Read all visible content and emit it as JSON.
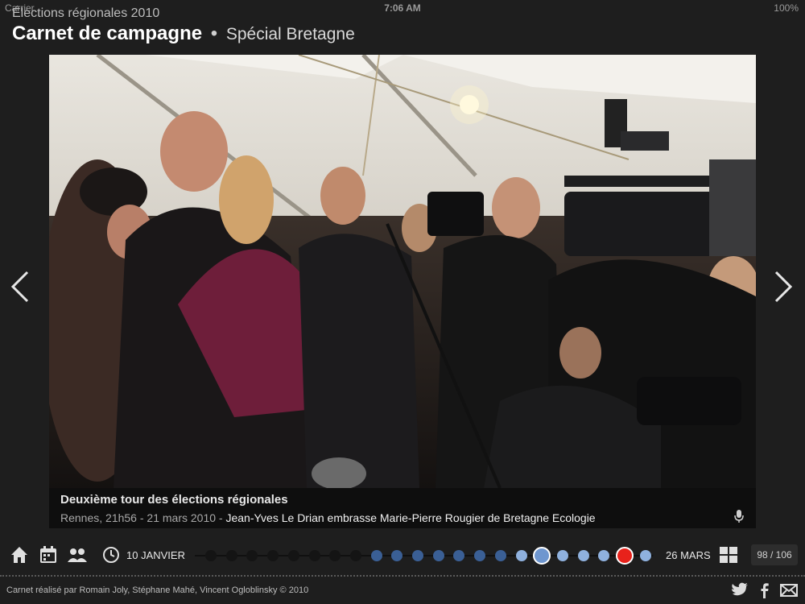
{
  "status": {
    "carrier": "Carrier",
    "time": "7:06 AM",
    "battery": "100%"
  },
  "header": {
    "kicker": "Élections régionales 2010",
    "title": "Carnet de campagne",
    "separator": "•",
    "subtitle": "Spécial Bretagne"
  },
  "photo": {
    "caption_title": "Deuxième tour des élections régionales",
    "place_time": "Rennes, 21h56 - 21 mars 2010 - ",
    "description": "Jean-Yves Le Drian embrasse Marie-Pierre Rougier de Bretagne Ecologie"
  },
  "toolbar": {
    "date_start": "10 JANVIER",
    "date_end": "26 MARS",
    "counter": "98 / 106",
    "icons": [
      "home-icon",
      "calendar-icon",
      "people-icon",
      "clock-icon",
      "grid-icon"
    ]
  },
  "timeline": {
    "dot_count": 22,
    "current_index": 16,
    "event_index": 20,
    "blue_start_index": 15
  },
  "footer": {
    "credits": "Carnet réalisé par Romain Joly, Stéphane Mahé, Vincent Ogloblinsky © 2010",
    "social": [
      "twitter-icon",
      "facebook-icon",
      "mail-icon"
    ]
  },
  "colors": {
    "background": "#1e1e1e",
    "event_red": "#e8221b",
    "current_blue": "#6e96cf",
    "dot_blue": "#8fb1de"
  }
}
